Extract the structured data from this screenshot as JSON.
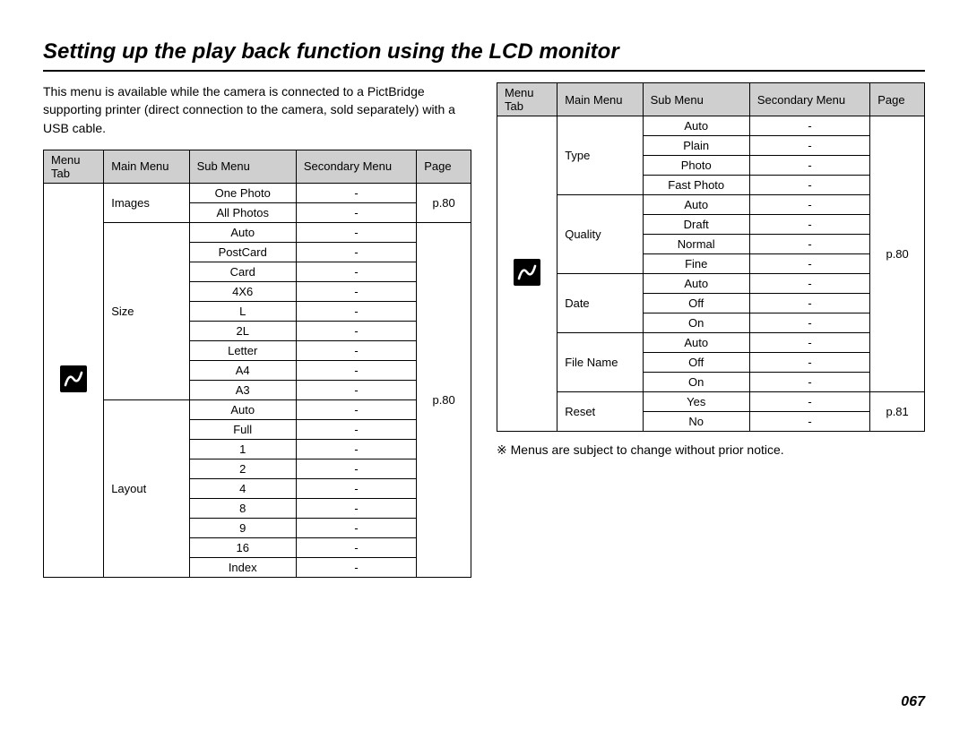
{
  "title": "Setting up the play back function using the LCD monitor",
  "intro": "This menu is available while the camera is connected to a PictBridge supporting printer (direct connection to the camera, sold separately) with a USB cable.",
  "headers": {
    "menu_tab": "Menu Tab",
    "main_menu": "Main Menu",
    "sub_menu": "Sub Menu",
    "secondary_menu": "Secondary Menu",
    "page": "Page"
  },
  "table1": {
    "page_ref1": "p.80",
    "page_ref2": "p.80",
    "images": {
      "label": "Images",
      "rows": [
        "One Photo",
        "All Photos"
      ]
    },
    "size": {
      "label": "Size",
      "rows": [
        "Auto",
        "PostCard",
        "Card",
        "4X6",
        "L",
        "2L",
        "Letter",
        "A4",
        "A3"
      ]
    },
    "layout": {
      "label": "Layout",
      "rows": [
        "Auto",
        "Full",
        "1",
        "2",
        "4",
        "8",
        "9",
        "16",
        "Index"
      ]
    }
  },
  "table2": {
    "page_ref1": "p.80",
    "page_ref2": "p.81",
    "type": {
      "label": "Type",
      "rows": [
        "Auto",
        "Plain",
        "Photo",
        "Fast Photo"
      ]
    },
    "quality": {
      "label": "Quality",
      "rows": [
        "Auto",
        "Draft",
        "Normal",
        "Fine"
      ]
    },
    "date": {
      "label": "Date",
      "rows": [
        "Auto",
        "Off",
        "On"
      ]
    },
    "filename": {
      "label": "File Name",
      "rows": [
        "Auto",
        "Off",
        "On"
      ]
    },
    "reset": {
      "label": "Reset",
      "rows": [
        "Yes",
        "No"
      ]
    }
  },
  "footnote": "※ Menus are subject to change without prior notice.",
  "page_number": "067",
  "dash": "-"
}
